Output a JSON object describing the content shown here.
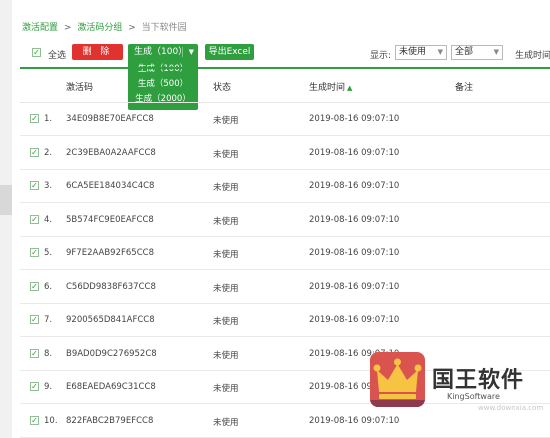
{
  "breadcrumb": {
    "item1": "激活配置",
    "sep1": ">",
    "item2": "激活码分组",
    "sep2": ">",
    "current": "当下软件园"
  },
  "toolbar": {
    "select_all_label": "全选",
    "delete_label": "删 除",
    "generate_label": "生成（100）",
    "generate_options": [
      "生成（100）",
      "生成（500）",
      "生成（2000）"
    ],
    "export_label": "导出Excel",
    "filter_label": "显示:",
    "status_filter_value": "未使用",
    "group_filter_value": "全部",
    "sort_label": "生成时间"
  },
  "table": {
    "headers": {
      "code": "激活码",
      "status": "状态",
      "time": "生成时间",
      "note": "备注"
    },
    "rows": [
      {
        "num": "1.",
        "code": "34E09B8E70EAFCC8",
        "status": "未使用",
        "time": "2019-08-16 09:07:10",
        "note": ""
      },
      {
        "num": "2.",
        "code": "2C39EBA0A2AAFCC8",
        "status": "未使用",
        "time": "2019-08-16 09:07:10",
        "note": ""
      },
      {
        "num": "3.",
        "code": "6CA5EE184034C4C8",
        "status": "未使用",
        "time": "2019-08-16 09:07:10",
        "note": ""
      },
      {
        "num": "4.",
        "code": "5B574FC9E0EAFCC8",
        "status": "未使用",
        "time": "2019-08-16 09:07:10",
        "note": ""
      },
      {
        "num": "5.",
        "code": "9F7E2AAB92F65CC8",
        "status": "未使用",
        "time": "2019-08-16 09:07:10",
        "note": ""
      },
      {
        "num": "6.",
        "code": "C56DD9838F637CC8",
        "status": "未使用",
        "time": "2019-08-16 09:07:10",
        "note": ""
      },
      {
        "num": "7.",
        "code": "9200565D841AFCC8",
        "status": "未使用",
        "time": "2019-08-16 09:07:10",
        "note": ""
      },
      {
        "num": "8.",
        "code": "B9AD0D9C276952C8",
        "status": "未使用",
        "time": "2019-08-16 09:07:10",
        "note": ""
      },
      {
        "num": "9.",
        "code": "E68EAEDA69C31CC8",
        "status": "未使用",
        "time": "2019-08-16 09:07:10",
        "note": ""
      },
      {
        "num": "10.",
        "code": "822FABC2B79EFCC8",
        "status": "未使用",
        "time": "2019-08-16 09:07:10",
        "note": ""
      }
    ]
  },
  "brand": {
    "name": "国王软件",
    "sub": "KingSoftware",
    "watermark": "www.downxia.com"
  },
  "colors": {
    "accent_green": "#2e9e3e",
    "delete_red": "#e0322f",
    "logo_red": "#d9534f",
    "crown_yellow": "#f6c343"
  }
}
